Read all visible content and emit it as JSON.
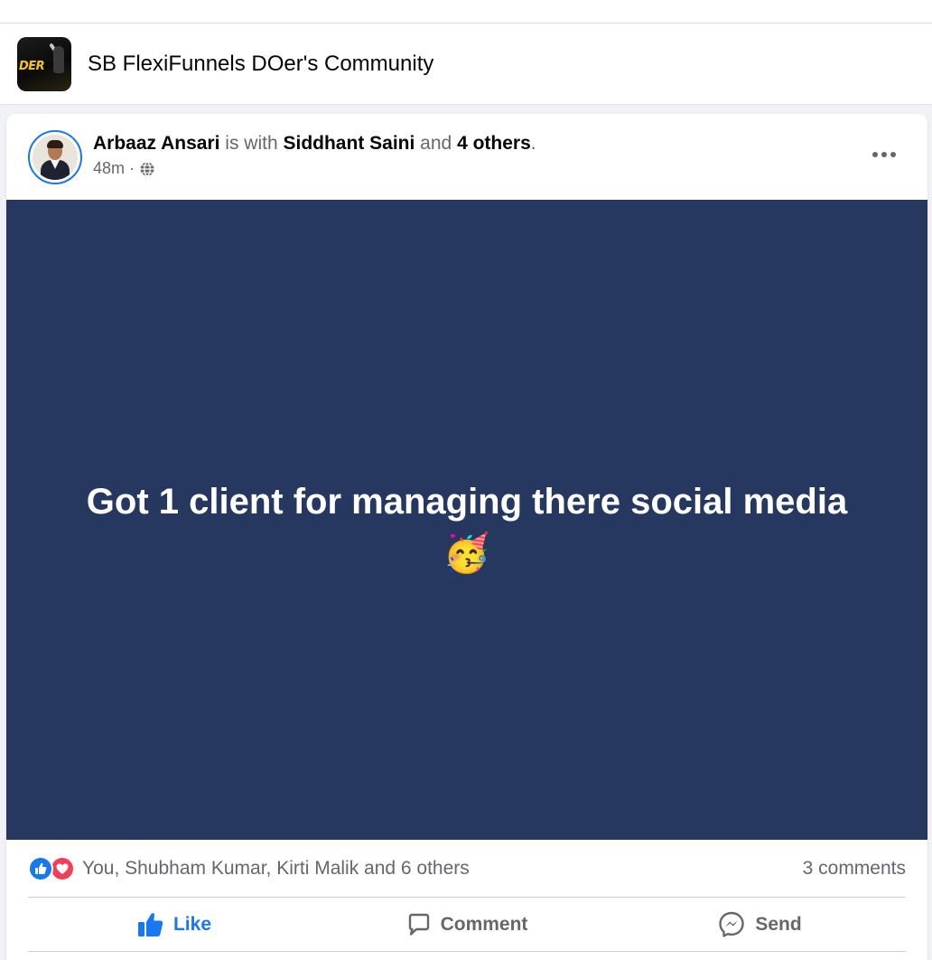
{
  "group": {
    "name": "SB FlexiFunnels DOer's Community",
    "logo_text": "DER"
  },
  "post": {
    "author": "Arbaaz Ansari",
    "with_text": "is with",
    "tagged_person": "Siddhant Saini",
    "and_text": "and",
    "others_text": "4 others",
    "period": ".",
    "time": "48m",
    "separator": "·",
    "privacy_icon": "globe-icon",
    "text": "Got 1 client for managing there social media",
    "emoji": "🥳",
    "background_color": "#263760"
  },
  "engagement": {
    "reaction_icons": [
      "like-icon",
      "love-icon"
    ],
    "reactions_text": "You, Shubham Kumar, Kirti Malik and 6 others",
    "comments_text": "3 comments"
  },
  "actions": {
    "like_label": "Like",
    "comment_label": "Comment",
    "send_label": "Send",
    "like_color": "#1877f2"
  }
}
